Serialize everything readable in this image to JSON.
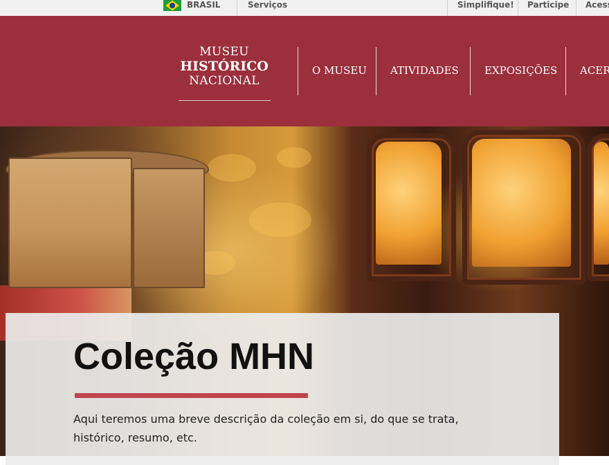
{
  "gov_bar": {
    "country": "BRASIL",
    "links": [
      "Serviços",
      "Simplifique!",
      "Participe",
      "Acess"
    ]
  },
  "header": {
    "logo": {
      "line1": "MUSEU",
      "line2": "HISTÓRICO",
      "line3": "NACIONAL"
    },
    "nav": [
      "O MUSEU",
      "ATIVIDADES",
      "EXPOSIÇÕES",
      "ACER"
    ]
  },
  "hero": {
    "title": "Coleção MHN",
    "description": "Aqui teremos uma breve descrição da coleção em si, do que se trata, histórico, resumo, etc."
  },
  "colors": {
    "brand": "#9b2f3b",
    "accent_rule": "#c0444d",
    "gov_bar": "#f1f1f1"
  },
  "icons": {
    "flag": "brazil-flag-icon"
  }
}
